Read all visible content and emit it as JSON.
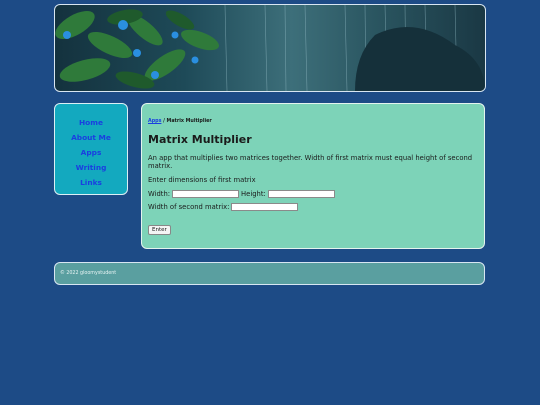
{
  "nav": {
    "items": [
      {
        "label": "Home"
      },
      {
        "label": "About Me"
      },
      {
        "label": "Apps"
      },
      {
        "label": "Writing"
      },
      {
        "label": "Links"
      }
    ]
  },
  "breadcrumb": {
    "parent": "Apps",
    "separator": "/",
    "current": "Matrix Multiplier"
  },
  "main": {
    "title": "Matrix Multiplier",
    "description": "An app that multiplies two matrices together. Width of first matrix must equal height of second matrix.",
    "prompt": "Enter dimensions of first matrix",
    "width_label": "Width:",
    "height_label": "Height:",
    "width2_label": "Width of second matrix:",
    "width_value": "",
    "height_value": "",
    "width2_value": "",
    "enter_label": "Enter"
  },
  "footer": {
    "text": "© 2022 gloomystudent"
  },
  "colors": {
    "background": "#1d4b86",
    "sidebar": "#13a9bf",
    "content": "#7dd3b8",
    "footer": "#5a9fa0",
    "link": "#1a3fe0"
  }
}
